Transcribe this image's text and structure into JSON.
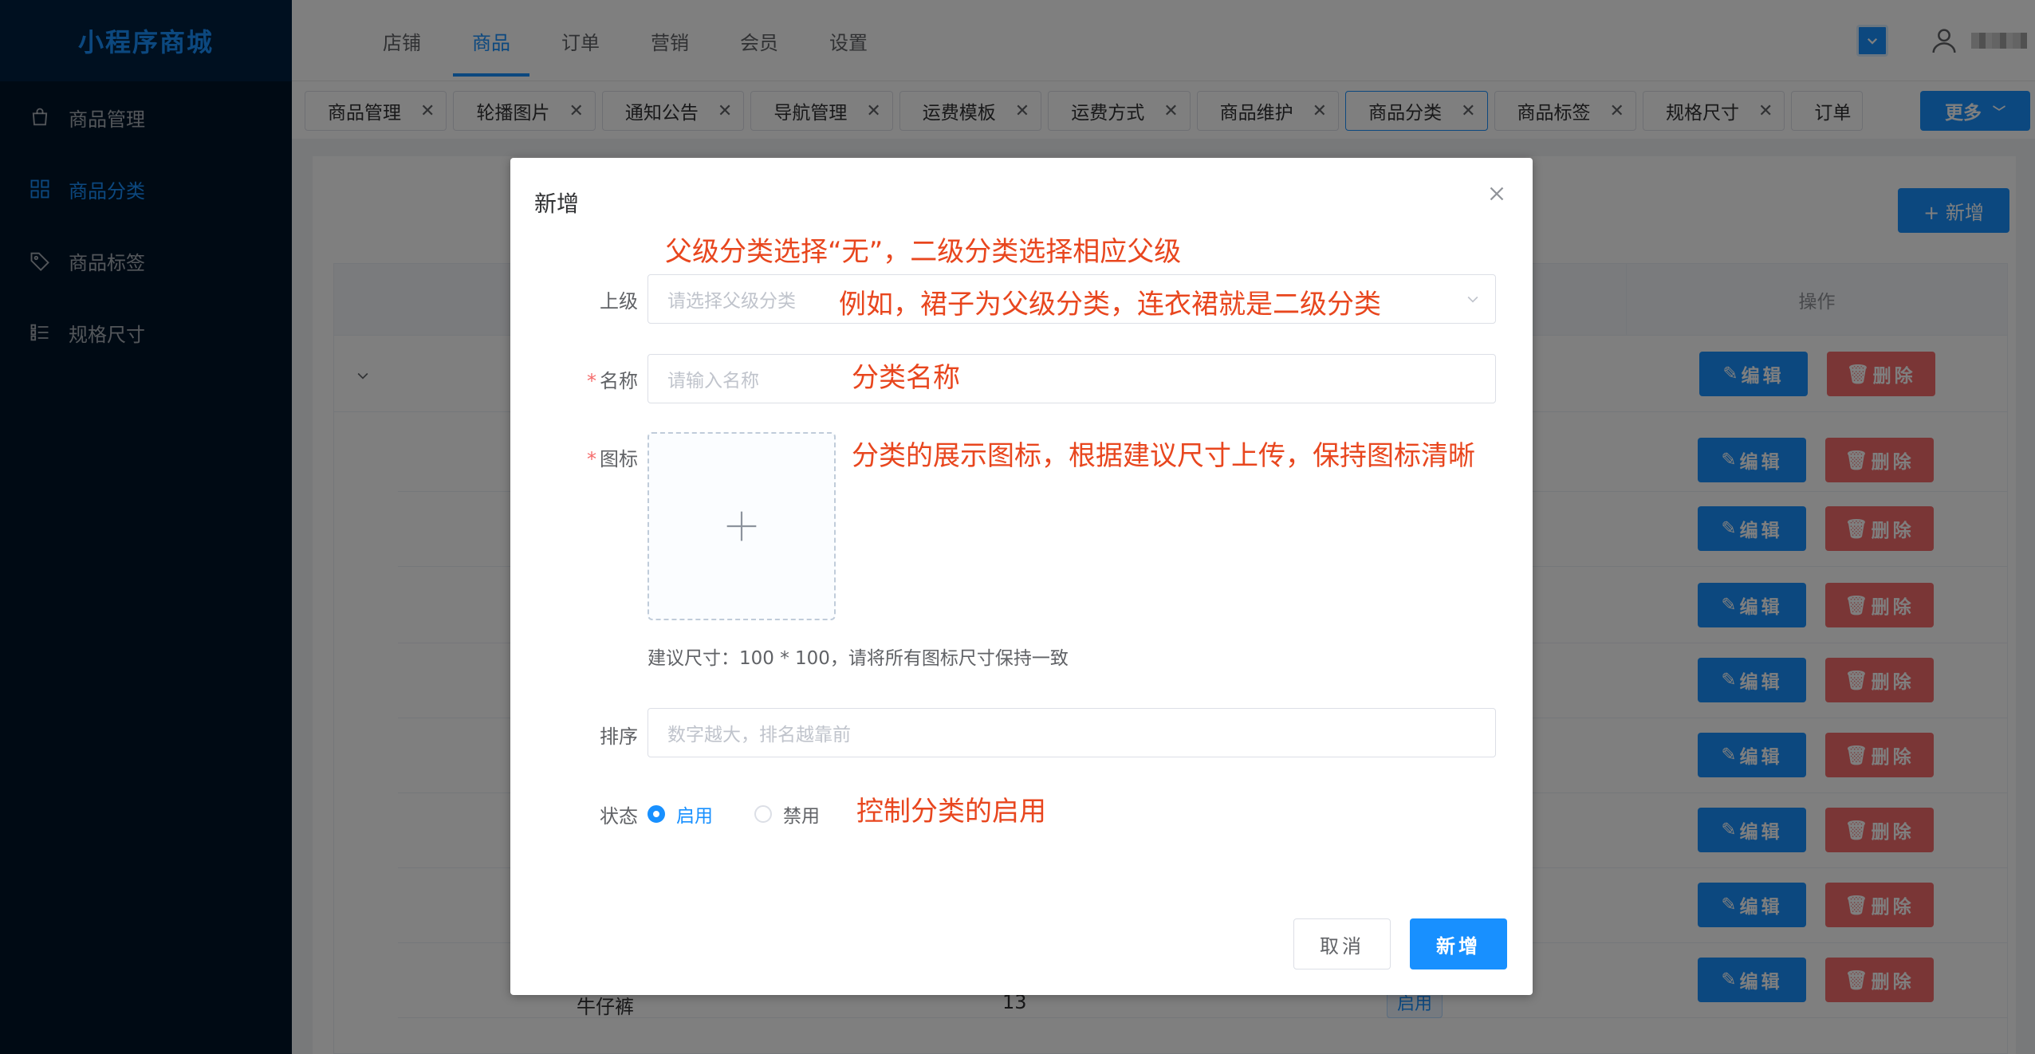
{
  "app": {
    "logo": "小程序商城"
  },
  "sidebar": {
    "items": [
      {
        "label": "商品管理",
        "icon": "bag-icon"
      },
      {
        "label": "商品分类",
        "icon": "grid-icon",
        "active": true
      },
      {
        "label": "商品标签",
        "icon": "tag-icon"
      },
      {
        "label": "规格尺寸",
        "icon": "list-icon"
      }
    ]
  },
  "topnav": {
    "items": [
      "店铺",
      "商品",
      "订单",
      "营销",
      "会员",
      "设置"
    ],
    "active": "商品"
  },
  "tabs": {
    "items": [
      "商品管理",
      "轮播图片",
      "通知公告",
      "导航管理",
      "运费模板",
      "运费方式",
      "商品维护",
      "商品分类",
      "商品标签",
      "规格尺寸",
      "订单"
    ],
    "active": "商品分类",
    "more_label": "更多"
  },
  "page": {
    "add_button": "+ 新增",
    "table_header_op": "操作",
    "edit_label": "编辑",
    "delete_label": "删除",
    "last_row": {
      "name": "牛仔裤",
      "sort": "13",
      "status": "启用"
    }
  },
  "modal": {
    "title": "新增",
    "parent_label": "上级",
    "parent_placeholder": "请选择父级分类",
    "name_label": "名称",
    "name_placeholder": "请输入名称",
    "icon_label": "图标",
    "icon_hint": "建议尺寸：100 * 100，请将所有图标尺寸保持一致",
    "sort_label": "排序",
    "sort_placeholder": "数字越大，排名越靠前",
    "status_label": "状态",
    "status_on": "启用",
    "status_off": "禁用",
    "status_value": "启用",
    "cancel": "取消",
    "submit": "新增",
    "required_mark": "*"
  },
  "annotations": {
    "a1": "父级分类选择“无”，二级分类选择相应父级",
    "a2": "例如，裙子为父级分类，连衣裙就是二级分类",
    "a3": "分类名称",
    "a4": "分类的展示图标，根据建议尺寸上传，保持图标清晰",
    "a5": "控制分类的启用"
  },
  "colors": {
    "primary": "#1890ff",
    "danger": "#f56c6c",
    "annotation": "#e8461e",
    "sidebar": "#001529"
  }
}
